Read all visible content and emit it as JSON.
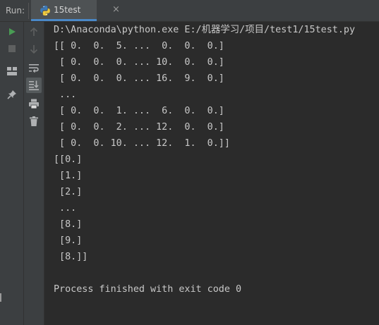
{
  "toolbar": {
    "run_label": "Run:",
    "tab_title": "15test",
    "tab_icon": "python-icon",
    "tab_close": "×"
  },
  "side_tools": {
    "outer": [
      "play-icon",
      "stop-icon",
      "layout-icon",
      "pin-icon"
    ],
    "inner": [
      "up-arrow-icon",
      "down-arrow-icon",
      "soft-wrap-icon",
      "scroll-to-end-icon",
      "print-icon",
      "trash-icon"
    ]
  },
  "console": {
    "lines": [
      "D:\\Anaconda\\python.exe E:/机器学习/项目/test1/15test.py",
      "[[ 0.  0.  5. ...  0.  0.  0.]",
      " [ 0.  0.  0. ... 10.  0.  0.]",
      " [ 0.  0.  0. ... 16.  9.  0.]",
      " ...",
      " [ 0.  0.  1. ...  6.  0.  0.]",
      " [ 0.  0.  2. ... 12.  0.  0.]",
      " [ 0.  0. 10. ... 12.  1.  0.]]",
      "[[0.]",
      " [1.]",
      " [2.]",
      " ...",
      " [8.]",
      " [9.]",
      " [8.]]",
      "",
      "Process finished with exit code 0"
    ]
  },
  "colors": {
    "background": "#2b2b2b",
    "panel": "#3c3f41",
    "text": "#c8c8c8",
    "run_green": "#499c54",
    "accent": "#4a88c7"
  }
}
